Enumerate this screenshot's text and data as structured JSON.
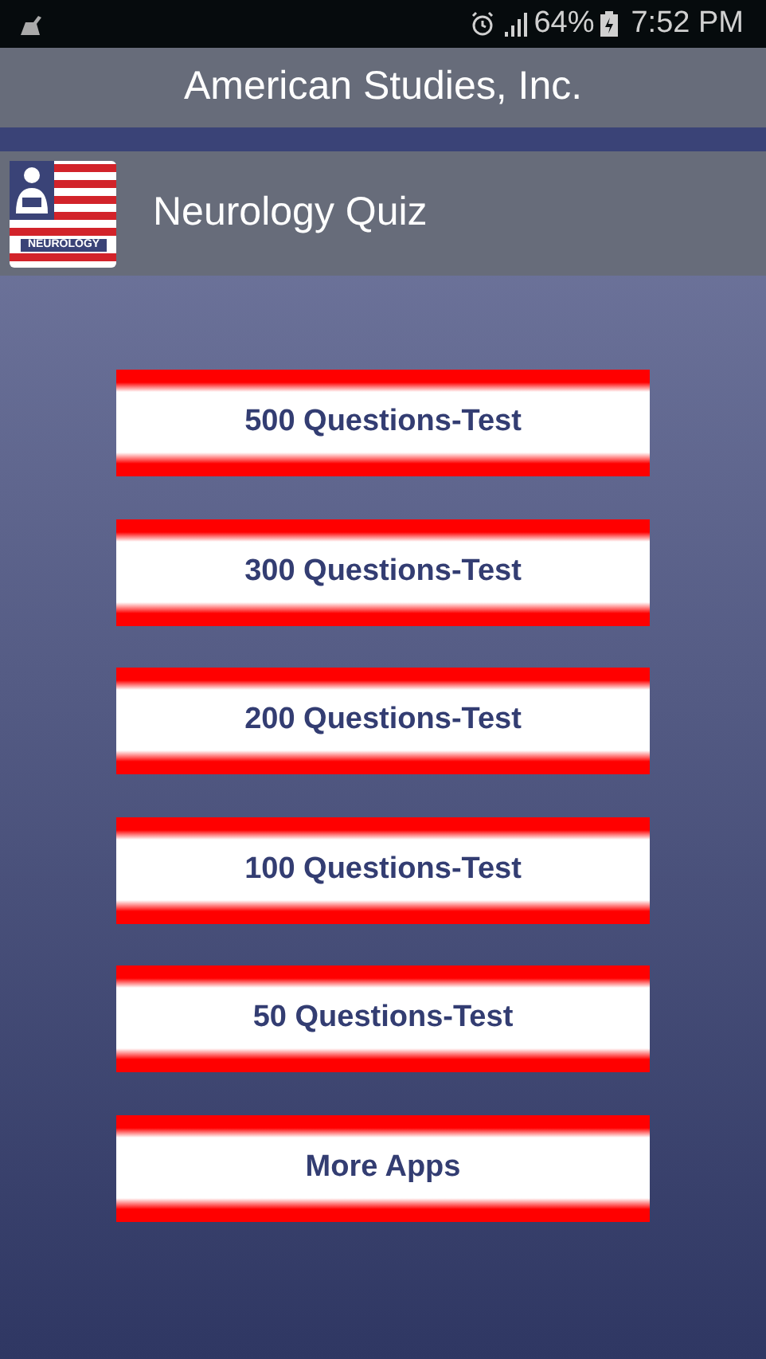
{
  "status_bar": {
    "battery": "64%",
    "time": "7:52 PM"
  },
  "title_bar": {
    "title": "American Studies, Inc."
  },
  "app_header": {
    "logo_text": "NEUROLOGY",
    "title": "Neurology Quiz"
  },
  "buttons": [
    {
      "label": "500 Questions-Test"
    },
    {
      "label": "300 Questions-Test"
    },
    {
      "label": "200 Questions-Test"
    },
    {
      "label": "100 Questions-Test"
    },
    {
      "label": "50 Questions-Test"
    },
    {
      "label": "More Apps"
    }
  ]
}
